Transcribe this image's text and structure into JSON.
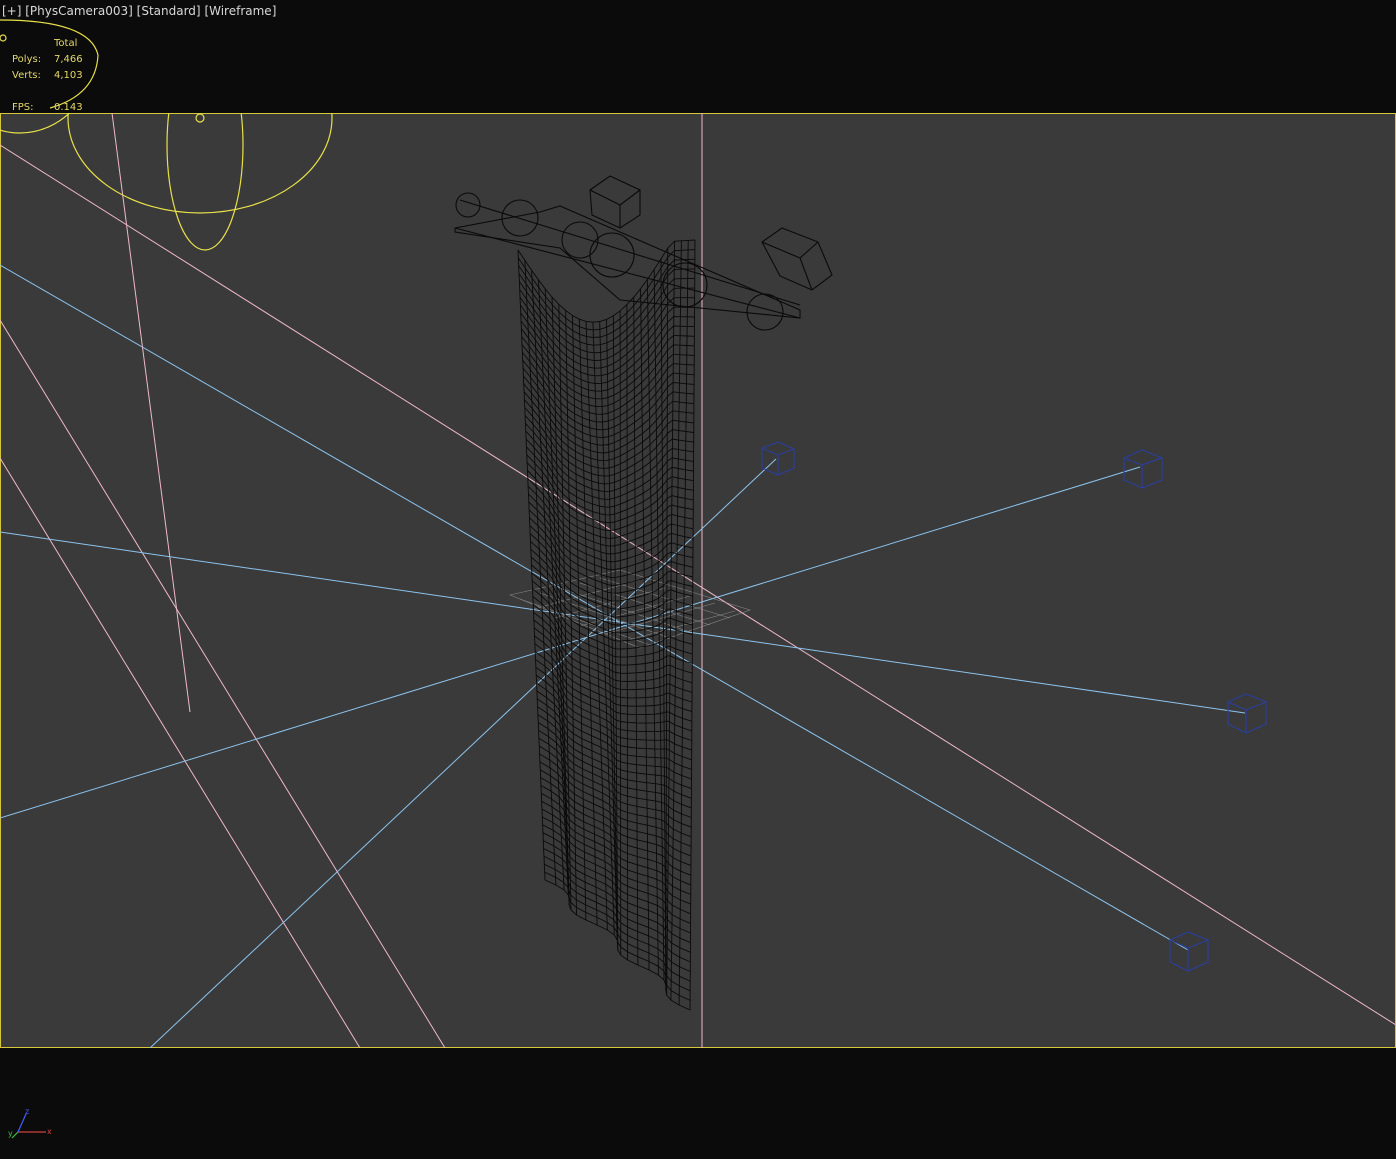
{
  "viewport": {
    "menu": "[+]",
    "camera": "[PhysCamera003]",
    "shading_mode": "[Standard]",
    "display_mode": "[Wireframe]"
  },
  "statistics": {
    "header": "Total",
    "polys_label": "Polys:",
    "polys_value": "7,466",
    "verts_label": "Verts:",
    "verts_value": "4,103",
    "fps_label": "FPS:",
    "fps_value": "0.143"
  },
  "axis_tripod": {
    "x_label": "x",
    "y_label": "y",
    "z_label": "z",
    "x_color": "#d04040",
    "y_color": "#40c040",
    "z_color": "#4060ff"
  },
  "colors": {
    "viewport_bg": "#3a3a3a",
    "safe_frame": "#d6c83a",
    "light_cone": "#8cc4ee",
    "camera_target": "#f0b8c8",
    "light_target_box": "#2a3f9a",
    "wireframe_mesh": "#0a0a0a",
    "helper_yellow": "#e8e04a",
    "grid_object": "#9a9a9a"
  }
}
